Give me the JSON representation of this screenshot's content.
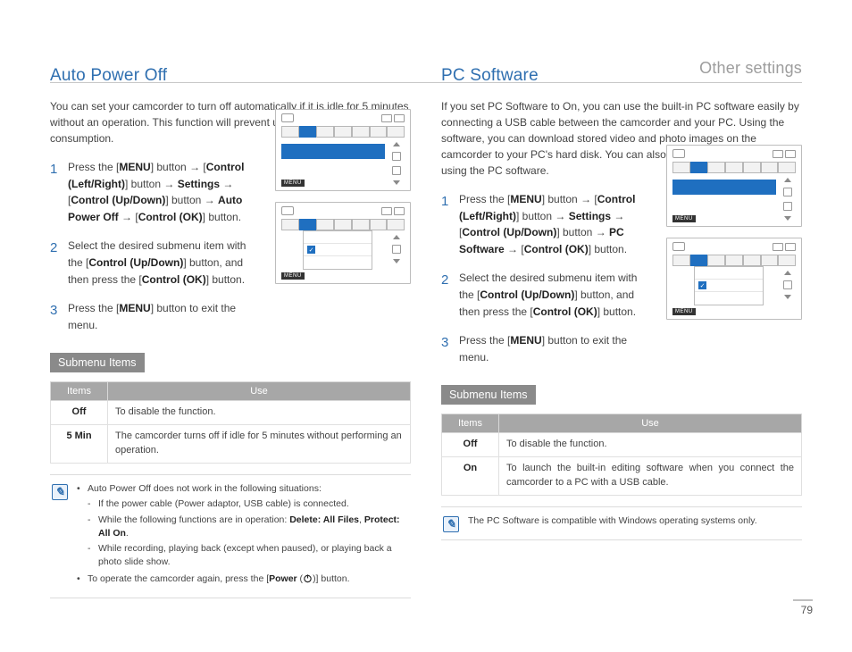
{
  "breadcrumb": "Other settings",
  "page_number": "79",
  "left": {
    "title": "Auto Power Off",
    "intro": "You can set your camcorder to turn off automatically if it is idle for 5 minutes without an operation. This function will prevent unnecessary power consumption.",
    "steps": [
      "Press the [<b>MENU</b>] button <span class='arrow'>→</span> [<b>Control (Left/Right)</b>] button <span class='arrow'>→</span> <b>Settings</b> <span class='arrow'>→</span> [<b>Control (Up/Down)</b>] button <span class='arrow'>→</span> <b>Auto Power Off</b> <span class='arrow'>→</span> [<b>Control (OK)</b>] button.",
      "Select the desired submenu item with the [<b>Control (Up/Down)</b>] button, and then press the [<b>Control (OK)</b>] button.",
      "Press the [<b>MENU</b>] button to exit the menu."
    ],
    "submenu_label": "Submenu Items",
    "table": {
      "head_items": "Items",
      "head_use": "Use",
      "rows": [
        {
          "k": "Off",
          "v": "To disable the function."
        },
        {
          "k": "5 Min",
          "v": "The camcorder turns off if idle for 5 minutes without performing an operation."
        }
      ]
    },
    "notes": [
      {
        "text": "Auto Power Off does not work in the following situations:",
        "sub": [
          "If the power cable (Power adaptor, USB cable) is connected.",
          "While the following functions are in operation: <b>Delete: All Files</b>, <b>Protect: All On</b>.",
          "While recording, playing back (except when paused), or playing back a photo slide show."
        ]
      },
      {
        "text": "To operate the camcorder again, press the [<b>Power</b> (<span class='power-icon'><svg width='11' height='11' viewBox='0 0 24 24'><circle cx='12' cy='13' r='8' fill='none' stroke='#222' stroke-width='2.5'/><line x1='12' y1='3' x2='12' y2='12' stroke='#222' stroke-width='2.5'/></svg></span>)] button."
      }
    ],
    "menu_label": "MENU"
  },
  "right": {
    "title": "PC Software",
    "intro": "If you set PC Software to On, you can use the built-in PC software easily by connecting a USB cable between the camcorder and your PC. Using the software, you can download stored video and photo images on the camcorder to your PC's hard disk. You can also edit video and photo files using the PC software.",
    "steps": [
      "Press the [<b>MENU</b>] button <span class='arrow'>→</span> [<b>Control (Left/Right)</b>] button <span class='arrow'>→</span> <b>Settings</b> <span class='arrow'>→</span> [<b>Control (Up/Down)</b>] button <span class='arrow'>→</span> <b>PC Software</b> <span class='arrow'>→</span> [<b>Control (OK)</b>] button.",
      "Select the desired submenu item with the [<b>Control (Up/Down)</b>] button, and then press the [<b>Control (OK)</b>] button.",
      "Press the [<b>MENU</b>] button to exit the menu."
    ],
    "submenu_label": "Submenu Items",
    "table": {
      "head_items": "Items",
      "head_use": "Use",
      "rows": [
        {
          "k": "Off",
          "v": "To disable the function."
        },
        {
          "k": "On",
          "v": "To launch the built-in editing software when you connect the camcorder to a PC with a USB cable."
        }
      ]
    },
    "note_single": "The PC Software is compatible with Windows operating systems only.",
    "menu_label": "MENU"
  }
}
